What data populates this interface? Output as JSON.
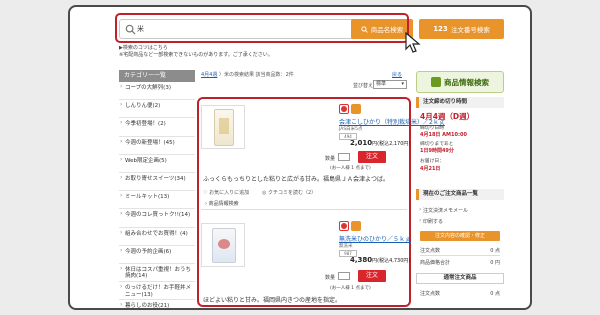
{
  "search": {
    "value": "米",
    "button_label": "商品名検索"
  },
  "order_search": {
    "prefix": "123",
    "label": "注文番号検索"
  },
  "tips": {
    "line1": "▶検索のコツはこちら",
    "line2": "※宅配商品など一部検索できないものがあります。ご了承ください。"
  },
  "sidebar": {
    "title": "カテゴリー一覧",
    "items": [
      "コープの大鮮列(3)",
      "しんりん便(2)",
      "今季初登場！(2)",
      "今週の新登場！(45)",
      "Web限定企画(5)",
      "お取り寄せスイーツ(34)",
      "ミールキット(13)",
      "今週のコレ買っトク!!(14)",
      "組み合わせでお買得！(4)",
      "今週の予約企画(6)",
      "休日はコスパ重視！おうち",
      "のっけるだけ！お手軽丼メ",
      "暮らしのお役(21)"
    ],
    "items_line2": [
      "",
      "",
      "",
      "",
      "",
      "",
      "",
      "",
      "",
      "",
      "焼肉(14)",
      "ニュー(13)",
      ""
    ]
  },
  "breadcrumb": {
    "week": "4月4週",
    "sep": "〉米の検索結果 該当商品数：",
    "count": "2件",
    "back": "戻る"
  },
  "sort": {
    "label": "並び替え",
    "selected": "標準"
  },
  "products": [
    {
      "name": "会津こしひかり（特別栽培米）／2ｋｇ",
      "sub": "JAS白米5点",
      "code": "494",
      "price": "2,010",
      "price_tax": "円(税込2,170円)",
      "qty_label": "数量",
      "cart_label": "注文",
      "limit": "(お一人様 1 点まで)",
      "desc": "ふっくらもっちりとした粘りと広がる甘み。福島県ＪＡ会津よつば。",
      "fav": "お気に入りに追加",
      "review": "クチコミを読む（2）",
      "info": "商品情報検索"
    },
    {
      "name": "無洗米ひのひかり／５ｋｇ",
      "sub": "無洗米",
      "code": "987",
      "price": "4,380",
      "price_tax": "円(税込4,730円)",
      "qty_label": "数量",
      "cart_label": "注文",
      "limit": "(お一人様 1 点まで)",
      "desc": "ほどよい粘りと甘み。福岡県内きつの産地を指定。"
    }
  ],
  "right": {
    "info_search": "商品情報検索",
    "deadline_title": "注文締め切り時間",
    "week": "4月4週（D週）",
    "deadline_label": "締切り日時",
    "deadline_value": "4月18日 AM10:00",
    "change_label": "締切りまであと",
    "change_value": "1日9時間49分",
    "delivery_label": "お届け日：",
    "delivery_value": "4月21日",
    "cart_title": "現在のご注文商品一覧",
    "memo_link": "注文決済メモメール",
    "print_link": "印刷する",
    "confirm_btn": "注文内容の確認・修正",
    "total_qty_label": "注文点数",
    "total_qty_value": "0 点",
    "total_price_label": "商品価格合計",
    "total_price_value": "0 円",
    "regular_title": "通常注文商品",
    "reg_qty_label": "注文点数",
    "reg_qty_value": "0 点"
  },
  "colors": {
    "accent": "#e8942a",
    "highlight": "#c0202a",
    "cart": "#d9262c",
    "link": "#1a5fb4"
  }
}
